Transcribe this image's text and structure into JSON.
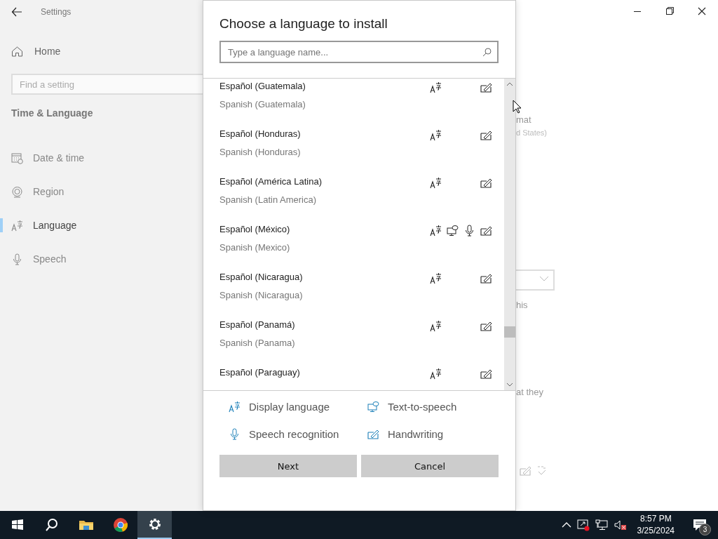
{
  "settings_window": {
    "title": "Settings",
    "home": "Home",
    "search": {
      "placeholder": "Find a setting"
    },
    "section": "Time & Language",
    "nav": [
      {
        "label": "Date & time",
        "kind": "calendar",
        "selected": false
      },
      {
        "label": "Region",
        "kind": "globe",
        "selected": false
      },
      {
        "label": "Language",
        "kind": "language",
        "selected": true
      },
      {
        "label": "Speech",
        "kind": "microphone",
        "selected": false
      }
    ],
    "background_fragments": [
      "mat",
      "d States)",
      "his",
      "at they"
    ]
  },
  "dialog": {
    "title": "Choose a language to install",
    "search": {
      "placeholder": "Type a language name..."
    },
    "languages": [
      {
        "name": "Español (Guatemala)",
        "english": "Spanish (Guatemala)",
        "display_language": true,
        "text_to_speech": false,
        "speech_recognition": false,
        "handwriting": true
      },
      {
        "name": "Español (Honduras)",
        "english": "Spanish (Honduras)",
        "display_language": true,
        "text_to_speech": false,
        "speech_recognition": false,
        "handwriting": true
      },
      {
        "name": "Español (América Latina)",
        "english": "Spanish (Latin America)",
        "display_language": true,
        "text_to_speech": false,
        "speech_recognition": false,
        "handwriting": true
      },
      {
        "name": "Español (México)",
        "english": "Spanish (Mexico)",
        "display_language": true,
        "text_to_speech": true,
        "speech_recognition": true,
        "handwriting": true
      },
      {
        "name": "Español (Nicaragua)",
        "english": "Spanish (Nicaragua)",
        "display_language": true,
        "text_to_speech": false,
        "speech_recognition": false,
        "handwriting": true
      },
      {
        "name": "Español (Panamá)",
        "english": "Spanish (Panama)",
        "display_language": true,
        "text_to_speech": false,
        "speech_recognition": false,
        "handwriting": true
      },
      {
        "name": "Español (Paraguay)",
        "display_language": true,
        "text_to_speech": false,
        "speech_recognition": false,
        "handwriting": true
      }
    ],
    "legend": [
      {
        "label": "Display language",
        "kind": "display"
      },
      {
        "label": "Text-to-speech",
        "kind": "tts"
      },
      {
        "label": "Speech recognition",
        "kind": "speech"
      },
      {
        "label": "Handwriting",
        "kind": "handwriting"
      }
    ],
    "buttons": [
      "Next",
      "Cancel"
    ]
  },
  "taskbar": {
    "apps": [
      {
        "kind": "start",
        "selected": false
      },
      {
        "kind": "search",
        "selected": false
      },
      {
        "kind": "folder",
        "selected": false
      },
      {
        "kind": "browser",
        "selected": false
      },
      {
        "kind": "settings",
        "selected": true
      }
    ],
    "time": "8:57 PM",
    "date": "3/25/2024",
    "notification_count": "3"
  }
}
